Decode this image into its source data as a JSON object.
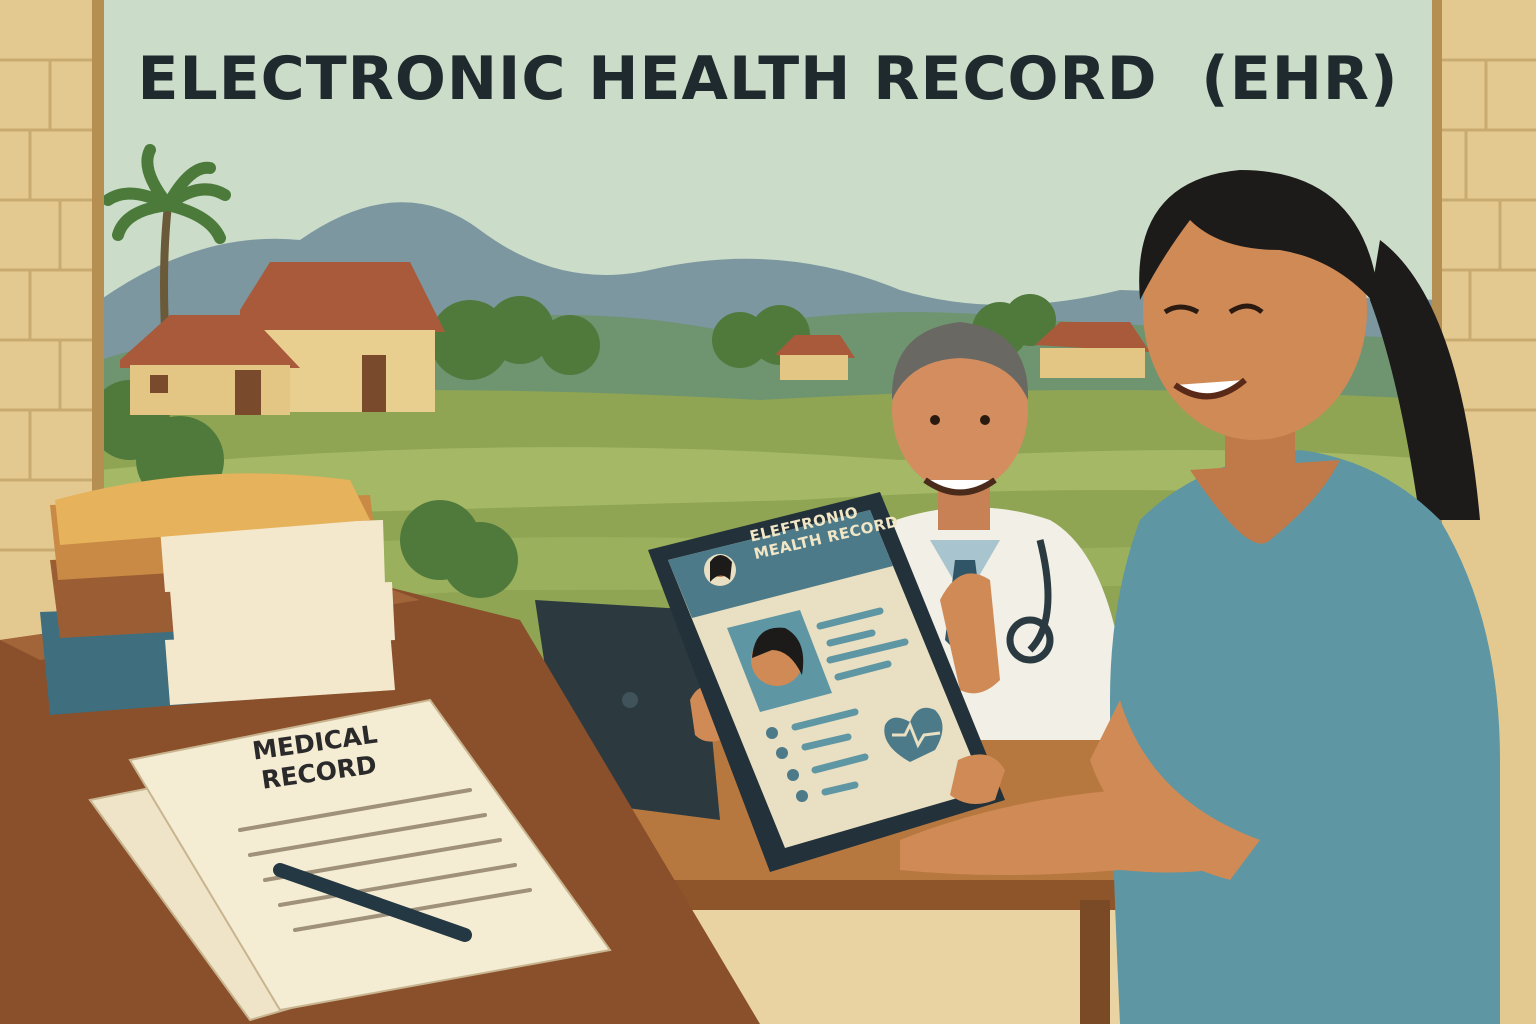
{
  "title": "ELECTRONIC HEALTH RECORD  (EHR)",
  "paper_document": {
    "line1": "MEDICAL",
    "line2": "RECORD"
  },
  "tablet_screen": {
    "header_line1": "ELEFTRONIO",
    "header_line2": "MEALTH RECORD"
  },
  "colors": {
    "sky": "#cbdcc9",
    "fields": "#8fa554",
    "hills": "#7c97a0",
    "brick_wall": "#e3c98f",
    "desk": "#8a4f2b",
    "scrubs": "#5e96a3",
    "tablet_frame": "#22313a",
    "tablet_screen": "#e9dfc2",
    "title_text": "#1f2a2e"
  }
}
